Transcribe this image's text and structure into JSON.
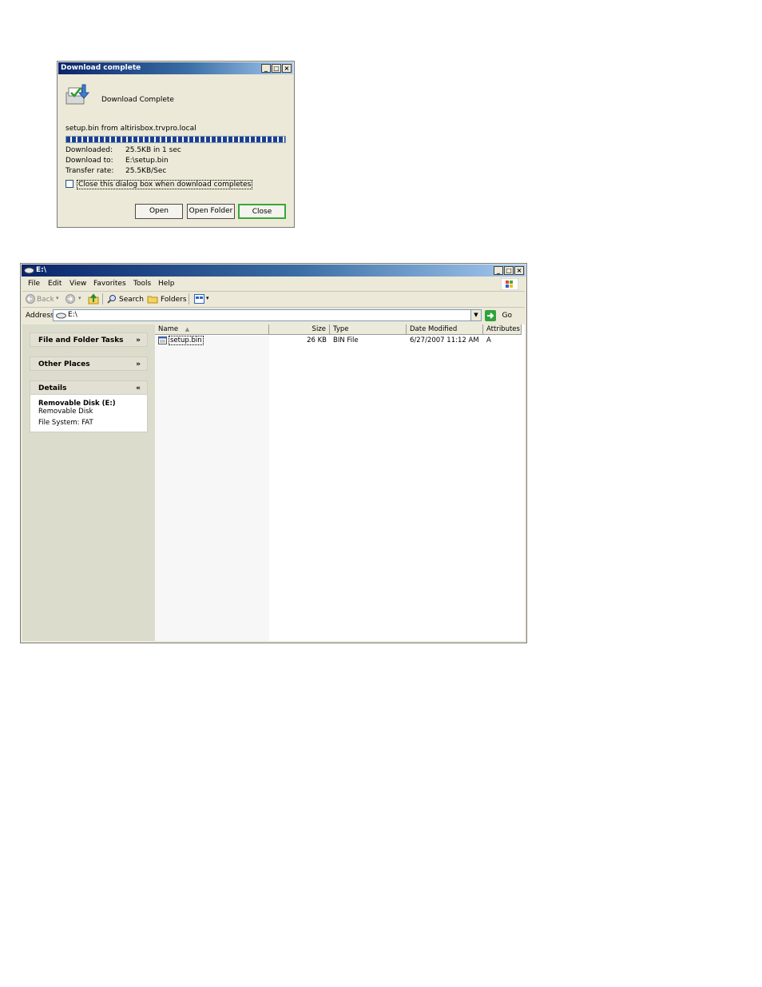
{
  "dialog": {
    "title": "Download complete",
    "heading": "Download Complete",
    "source": "setup.bin from altirisbox.trvpro.local",
    "progress_fraction": 1.0,
    "downloaded_label": "Downloaded:",
    "downloaded_value": "25.5KB in 1 sec",
    "download_to_label": "Download to:",
    "download_to_value": "E:\\setup.bin",
    "transfer_rate_label": "Transfer rate:",
    "transfer_rate_value": "25.5KB/Sec",
    "checkbox_label": "Close this dialog box when download completes",
    "checkbox_checked": false,
    "buttons": {
      "open": "Open",
      "open_folder": "Open Folder",
      "close": "Close"
    }
  },
  "explorer": {
    "title": "E:\\",
    "menu": [
      "File",
      "Edit",
      "View",
      "Favorites",
      "Tools",
      "Help"
    ],
    "toolbar": {
      "back": "Back",
      "search": "Search",
      "folders": "Folders"
    },
    "address_label": "Address",
    "address_value": "E:\\",
    "go_label": "Go",
    "tasks": {
      "file_folder_tasks": "File and Folder Tasks",
      "other_places": "Other Places",
      "details": "Details",
      "details_title": "Removable Disk (E:)",
      "details_type": "Removable Disk",
      "details_fs": "File System: FAT"
    },
    "columns": {
      "name": "Name",
      "size": "Size",
      "type": "Type",
      "date": "Date Modified",
      "attributes": "Attributes"
    },
    "files": [
      {
        "name": "setup.bin",
        "size": "26 KB",
        "type": "BIN File",
        "date": "6/27/2007 11:12 AM",
        "attributes": "A"
      }
    ]
  }
}
